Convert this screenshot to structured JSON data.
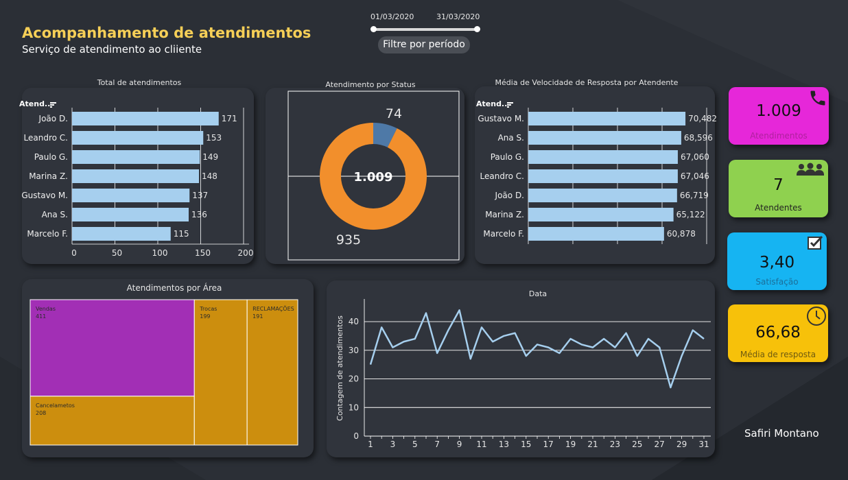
{
  "header": {
    "title": "Acompanhamento de atendimentos",
    "subtitle": "Serviço de atendimento ao cliiente"
  },
  "filter": {
    "start_date": "01/03/2020",
    "end_date": "31/03/2020",
    "button_label": "Filtre por período"
  },
  "colors": {
    "background": "#2b2f36",
    "card": "#30343c",
    "bar": "#a6cfee",
    "title_yellow": "#f6cf57",
    "donut_orange": "#f28f2c",
    "donut_blue": "#4e79a7",
    "treemap_purple": "#a22fb5",
    "treemap_gold": "#cc8e0e",
    "kpi_magenta": "#e627d9",
    "kpi_green": "#8fd14f",
    "kpi_cyan": "#16b4f2",
    "kpi_yellow": "#f7c10a",
    "line": "#a6cfee"
  },
  "total_atendimentos": {
    "title": "Total de atendimentos",
    "column_header": "Atend..",
    "sort_icon": "sort-icon",
    "chart_data": {
      "type": "bar",
      "categories": [
        "João D.",
        "Leandro C.",
        "Paulo G.",
        "Marina Z.",
        "Gustavo M.",
        "Ana S.",
        "Marcelo F."
      ],
      "values": [
        171,
        153,
        149,
        148,
        137,
        136,
        115
      ],
      "value_labels": [
        "171",
        "153",
        "149",
        "148",
        "137",
        "136",
        "115"
      ],
      "xticks": [
        "0",
        "50",
        "100",
        "150",
        "200"
      ],
      "xlim": [
        0,
        200
      ],
      "grid": true
    }
  },
  "status": {
    "title": "Atendimento por Status",
    "center_label": "1.009",
    "chart_data": {
      "type": "pie",
      "values": [
        74,
        935
      ],
      "labels": [
        "74",
        "935"
      ],
      "colors": [
        "#4e79a7",
        "#f28f2c"
      ]
    }
  },
  "velocidade": {
    "title": "Média de Velocidade de Resposta por Atendente",
    "column_header": "Atend..",
    "sort_icon": "sort-icon",
    "chart_data": {
      "type": "bar",
      "categories": [
        "Gustavo M.",
        "Ana S.",
        "Paulo G.",
        "Leandro C.",
        "João D.",
        "Marina Z.",
        "Marcelo F."
      ],
      "values": [
        70.482,
        68.596,
        67.06,
        67.046,
        66.719,
        65.122,
        60.878
      ],
      "value_labels": [
        "70,482",
        "68,596",
        "67,060",
        "67,046",
        "66,719",
        "65,122",
        "60,878"
      ],
      "xlim": [
        0,
        80
      ],
      "grid": true
    }
  },
  "kpis": [
    {
      "value": "1.009",
      "label": "Atendimentos",
      "icon": "phone-icon",
      "color": "#e627d9"
    },
    {
      "value": "7",
      "label": "Atendentes",
      "icon": "people-icon",
      "color": "#8fd14f"
    },
    {
      "value": "3,40",
      "label": "Satisfação",
      "icon": "checkbox-icon",
      "color": "#16b4f2"
    },
    {
      "value": "66,68",
      "label": "Média de resposta",
      "icon": "clock-icon",
      "color": "#f7c10a"
    }
  ],
  "area": {
    "title": "Atendimentos por Área",
    "chart_data": {
      "type": "treemap",
      "items": [
        {
          "name": "Vendas",
          "value": 411,
          "value_label": "411",
          "color": "#a22fb5"
        },
        {
          "name": "Cancelametos",
          "value": 208,
          "value_label": "208",
          "color": "#cc8e0e"
        },
        {
          "name": "Trocas",
          "value": 199,
          "value_label": "199",
          "color": "#cc8e0e"
        },
        {
          "name": "RECLAMAÇÕES",
          "value": 191,
          "value_label": "191",
          "color": "#cc8e0e"
        }
      ]
    }
  },
  "data_chart": {
    "title": "Data",
    "ylabel": "Contagem de atendimentos",
    "chart_data": {
      "type": "line",
      "x": [
        1,
        2,
        3,
        4,
        5,
        6,
        7,
        8,
        9,
        10,
        11,
        12,
        13,
        14,
        15,
        16,
        17,
        18,
        19,
        20,
        21,
        22,
        23,
        24,
        25,
        26,
        27,
        28,
        29,
        30,
        31
      ],
      "values": [
        25,
        38,
        31,
        33,
        34,
        43,
        29,
        37,
        44,
        27,
        38,
        33,
        35,
        36,
        28,
        32,
        31,
        29,
        34,
        32,
        31,
        34,
        31,
        36,
        28,
        34,
        31,
        17,
        28,
        37,
        34
      ],
      "xticks": [
        "1",
        "3",
        "5",
        "7",
        "9",
        "11",
        "13",
        "15",
        "17",
        "19",
        "21",
        "23",
        "25",
        "27",
        "29",
        "31"
      ],
      "yticks": [
        "0",
        "10",
        "20",
        "30",
        "40"
      ],
      "ylim": [
        0,
        46
      ],
      "grid": true
    }
  },
  "author": "Safiri Montano"
}
